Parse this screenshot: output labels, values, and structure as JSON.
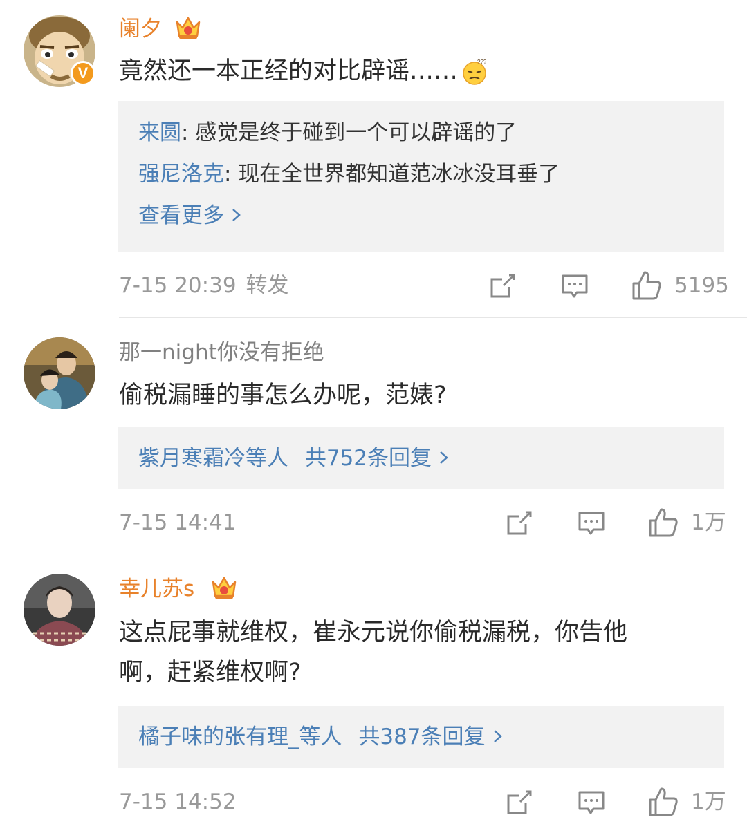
{
  "comments": [
    {
      "username": "阑夕",
      "vip": true,
      "verified_badge": "V",
      "text": "竟然还一本正经的对比辟谣……",
      "emoji": "thinking-emoji",
      "replies": [
        {
          "name": "来圆",
          "text": ": 感觉是终于碰到一个可以辟谣的了"
        },
        {
          "name": "强尼洛克",
          "text": ": 现在全世界都知道范冰冰没耳垂了"
        }
      ],
      "more_label": "查看更多",
      "time": "7-15 20:39",
      "source": "转发",
      "likes": "5195"
    },
    {
      "username": "那一night你没有拒绝",
      "vip": false,
      "text": "偷税漏睡的事怎么办呢，范婊?",
      "reply_summary": {
        "names": "紫月寒霜冷等人",
        "count": "共752条回复"
      },
      "time": "7-15 14:41",
      "likes": "1万"
    },
    {
      "username": "幸儿苏s",
      "vip": true,
      "text_lines": [
        "这点屁事就维权，崔永元说你偷税漏税，你告他",
        "啊，赶紧维权啊?"
      ],
      "reply_summary": {
        "names": "橘子味的张有理_等人",
        "count": "共387条回复"
      },
      "time": "7-15 14:52",
      "likes": "1万"
    }
  ],
  "colors": {
    "username_vip": "#e8822b",
    "username_normal": "#808080",
    "link": "#4b7fb6",
    "reply_bg": "#f2f2f2",
    "meta": "#999999",
    "badge": "#f39a1e"
  }
}
